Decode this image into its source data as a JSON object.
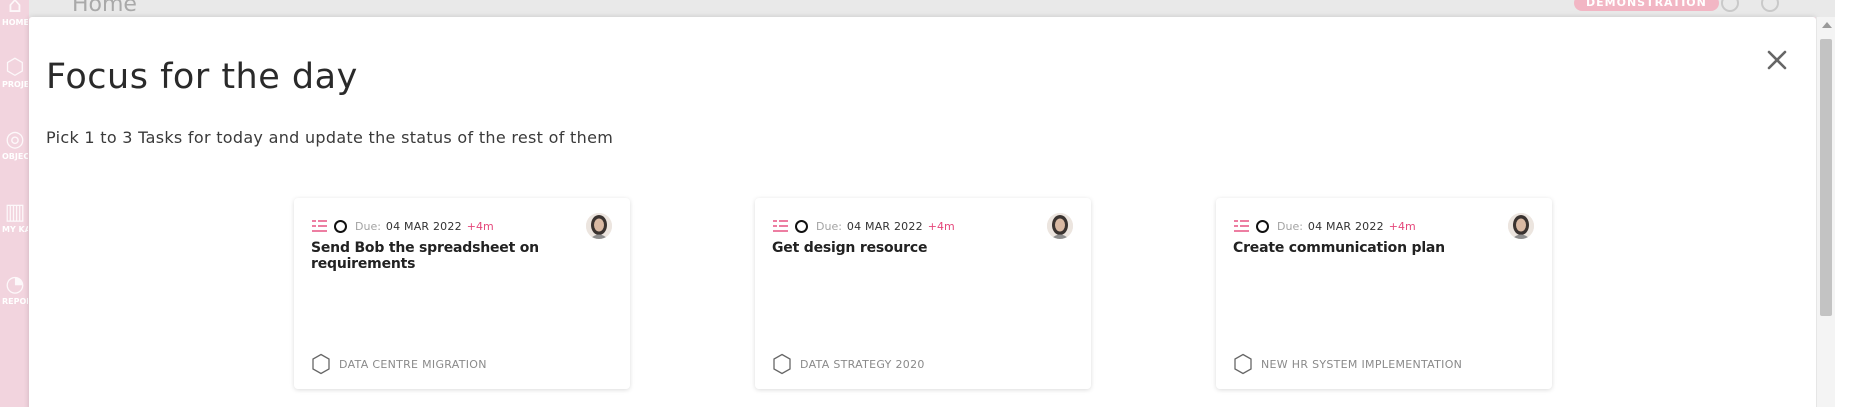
{
  "background": {
    "page_title": "Home",
    "badge": "DEMONSTRATION",
    "sidebar": [
      {
        "label": "HOME",
        "icon": "home-icon"
      },
      {
        "label": "PROJECTS",
        "icon": "hexagon-icon"
      },
      {
        "label": "OBJECTIVES",
        "icon": "target-icon"
      },
      {
        "label": "MY KANBAN",
        "icon": "kanban-icon"
      },
      {
        "label": "REPORTS",
        "icon": "reports-icon"
      }
    ]
  },
  "modal": {
    "title": "Focus for the day",
    "subtitle": "Pick 1 to 3 Tasks for today and update the status of the rest of them",
    "close_icon": "close-icon"
  },
  "cards": [
    {
      "due_label": "Due:",
      "due_date": "04 MAR 2022",
      "overdue": "+4m",
      "title": "Send Bob the spreadsheet on requirements",
      "project": "DATA CENTRE MIGRATION"
    },
    {
      "due_label": "Due:",
      "due_date": "04 MAR 2022",
      "overdue": "+4m",
      "title": "Get design resource",
      "project": "DATA STRATEGY 2020"
    },
    {
      "due_label": "Due:",
      "due_date": "04 MAR 2022",
      "overdue": "+4m",
      "title": "Create communication plan",
      "project": "NEW HR SYSTEM IMPLEMENTATION"
    }
  ],
  "colors": {
    "accent": "#e5477a",
    "sidebar_bg": "#f2d4de",
    "modal_bg": "#ffffff"
  }
}
